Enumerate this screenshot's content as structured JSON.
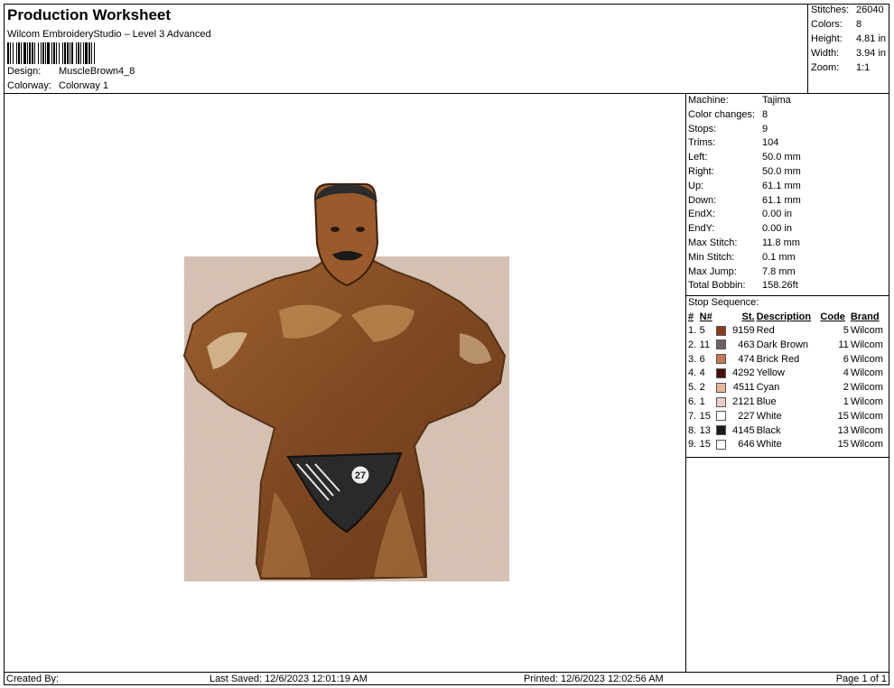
{
  "header": {
    "title": "Production Worksheet",
    "subtitle": "Wilcom EmbroideryStudio – Level 3 Advanced",
    "design_label": "Design:",
    "design_value": "MuscleBrown4_8",
    "colorway_label": "Colorway:",
    "colorway_value": "Colorway 1"
  },
  "stats": [
    {
      "label": "Stitches:",
      "value": "26040"
    },
    {
      "label": "Colors:",
      "value": "8"
    },
    {
      "label": "Height:",
      "value": "4.81 in"
    },
    {
      "label": "Width:",
      "value": "3.94 in"
    },
    {
      "label": "Zoom:",
      "value": "1:1"
    }
  ],
  "properties": [
    {
      "label": "Machine:",
      "value": "Tajima"
    },
    {
      "label": "Color changes:",
      "value": "8"
    },
    {
      "label": "Stops:",
      "value": "9"
    },
    {
      "label": "Trims:",
      "value": "104"
    },
    {
      "label": "Left:",
      "value": "50.0 mm"
    },
    {
      "label": "Right:",
      "value": "50.0 mm"
    },
    {
      "label": "Up:",
      "value": "61.1 mm"
    },
    {
      "label": "Down:",
      "value": "61.1 mm"
    },
    {
      "label": "EndX:",
      "value": "0.00 in"
    },
    {
      "label": "EndY:",
      "value": "0.00 in"
    },
    {
      "label": "Max Stitch:",
      "value": "11.8 mm"
    },
    {
      "label": "Min Stitch:",
      "value": "0.1 mm"
    },
    {
      "label": "Max Jump:",
      "value": "7.8 mm"
    },
    {
      "label": "Total Bobbin:",
      "value": "158.26ft"
    }
  ],
  "stop_sequence": {
    "title": "Stop Sequence:",
    "headers": {
      "num": "#",
      "n": "N#",
      "st": "St.",
      "description": "Description",
      "code": "Code",
      "brand": "Brand"
    },
    "rows": [
      {
        "num": "1.",
        "n": "5",
        "color": "#8B3A1E",
        "st": "9159",
        "description": "Red",
        "code": "5",
        "brand": "Wilcom"
      },
      {
        "num": "2.",
        "n": "11",
        "color": "#6E6262",
        "st": "463",
        "description": "Dark Brown",
        "code": "11",
        "brand": "Wilcom"
      },
      {
        "num": "3.",
        "n": "6",
        "color": "#C8775A",
        "st": "474",
        "description": "Brick Red",
        "code": "6",
        "brand": "Wilcom"
      },
      {
        "num": "4.",
        "n": "4",
        "color": "#4A0E08",
        "st": "4292",
        "description": "Yellow",
        "code": "4",
        "brand": "Wilcom"
      },
      {
        "num": "5.",
        "n": "2",
        "color": "#E8B89A",
        "st": "4511",
        "description": "Cyan",
        "code": "2",
        "brand": "Wilcom"
      },
      {
        "num": "6.",
        "n": "1",
        "color": "#E6CFC0",
        "st": "2121",
        "description": "Blue",
        "code": "1",
        "brand": "Wilcom"
      },
      {
        "num": "7.",
        "n": "15",
        "color": "#FFFFFF",
        "st": "227",
        "description": "White",
        "code": "15",
        "brand": "Wilcom"
      },
      {
        "num": "8.",
        "n": "13",
        "color": "#1A1A1A",
        "st": "4145",
        "description": "Black",
        "code": "13",
        "brand": "Wilcom"
      },
      {
        "num": "9.",
        "n": "15",
        "color": "#FFFFFF",
        "st": "646",
        "description": "White",
        "code": "15",
        "brand": "Wilcom"
      }
    ]
  },
  "design": {
    "trunks_number": "27"
  },
  "footer": {
    "created_by": "Created By:",
    "last_saved": "Last Saved: 12/6/2023 12:01:19 AM",
    "printed": "Printed: 12/6/2023 12:02:56 AM",
    "page": "Page 1 of 1"
  }
}
